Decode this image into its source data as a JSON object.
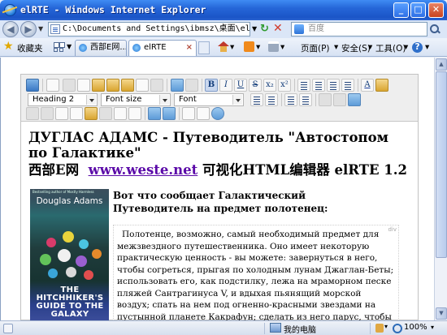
{
  "window": {
    "title": "elRTE - Windows Internet Explorer",
    "controls": {
      "minimize": "_",
      "maximize": "□",
      "close": "✕"
    }
  },
  "address_bar": {
    "url": "C:\\Documents and Settings\\ibmsz\\桌面\\elrte-1",
    "search_placeholder": "百度"
  },
  "favorites_bar": {
    "favorites_label": "收藏夹",
    "tabs": [
      {
        "label": "西部E网...",
        "active": false
      },
      {
        "label": "elRTE",
        "active": true
      }
    ],
    "commands": {
      "page": "页面(P)",
      "safety": "安全(S)",
      "tools": "工具(O)",
      "help": "?"
    }
  },
  "editor": {
    "toolbar": {
      "format_select": "Heading 2",
      "font_size_select": "Font size",
      "font_family_select": "Font"
    },
    "content": {
      "heading": "ДУГЛАС АДАМС - Путеводитель \"Автостопом по Галактике\"",
      "heading2_prefix": "西部E网",
      "heading2_link": "www.weste.net",
      "heading2_suffix": "可视化HTML编辑器  elRTE 1.2",
      "book": {
        "publisher_text": "Bestselling author of Mostly Harmless",
        "author": "Douglas Adams",
        "title": "THE HITCHHIKER'S GUIDE TO THE GALAXY"
      },
      "intro": "Вот что сообщает Галактический Путеводитель на предмет полотенец:",
      "blockquote_tag": "div",
      "quote": "Полотенце, возможно, самый необходимый предмет для межзвездного путешественника. Оно имеет некоторую практическую ценность - вы можете: завернуться в него, чтобы согреться, прыгая по холодным лунам Джаглан-Беты; использовать его, как подстилку, лежа на мраморном песке пляжей Сантрагинуса V, и вдыхая пьянящий  морской воздух; спать на нем под огненно-красными звездами на пустынной планете Какрафун; сделать из него парус, чтобы спуститься на плоту по ленивой реке Мотт; намочить его и"
    }
  },
  "status_bar": {
    "zone": "我的电脑",
    "zoom": "100%"
  },
  "colors": {
    "title_bar": "#2566d8",
    "link": "#5b0aa8",
    "toolbar_bg": "#eeeeee"
  }
}
